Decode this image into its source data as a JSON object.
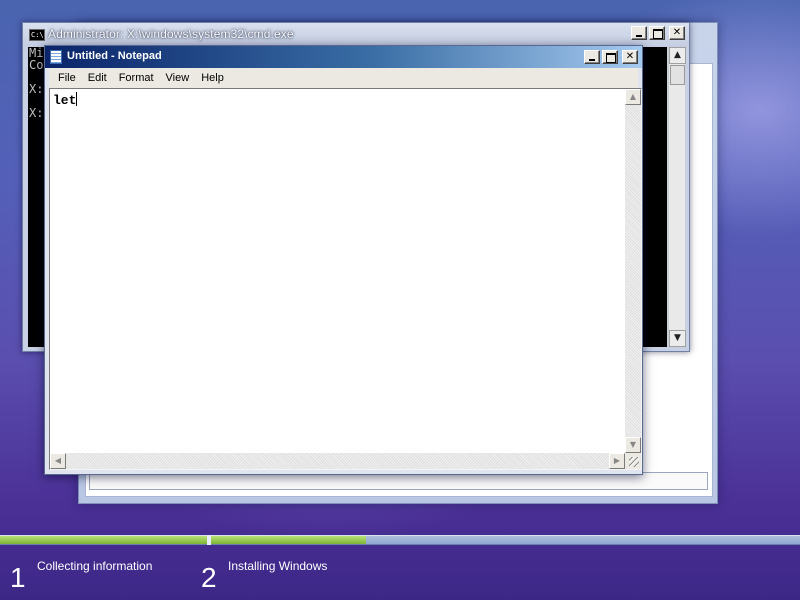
{
  "cmd_window": {
    "title": "Administrator: X:\\windows\\system32\\cmd.exe",
    "icon": "C:\\",
    "lines": [
      "Mi",
      "Co",
      "",
      "X:",
      "",
      "X:"
    ]
  },
  "notepad": {
    "title": "Untitled - Notepad",
    "menu": [
      "File",
      "Edit",
      "Format",
      "View",
      "Help"
    ],
    "content": "let"
  },
  "setup": {
    "progress_fraction": 0.46,
    "steps": [
      {
        "number": "1",
        "label": "Collecting information"
      },
      {
        "number": "2",
        "label": "Installing Windows"
      }
    ]
  },
  "colors": {
    "progress_green": "#7cb434",
    "notepad_title_start": "#0a246a"
  }
}
